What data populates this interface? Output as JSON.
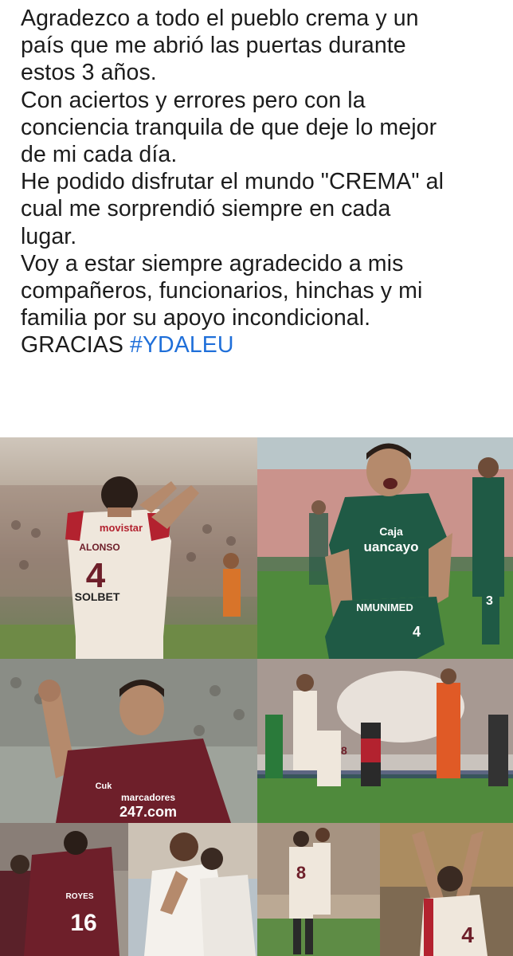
{
  "post": {
    "lines": [
      "Agradezco a todo el pueblo crema y un",
      "país que me abrió las puertas durante",
      "estos 3 años.",
      "Con aciertos y errores pero con la",
      "conciencia tranquila de que deje lo mejor",
      "de mi cada día.",
      "He podido disfrutar el mundo \"CREMA\" al",
      "cual me sorprendió siempre en cada",
      "lugar.",
      "Voy a estar siempre agradecido a mis",
      "compañeros, funcionarios, hinchas y mi",
      "familia por su apoyo incondicional."
    ],
    "last_prefix": "GRACIAS ",
    "hashtag": "#YDALEU",
    "hashtag_color": "#1f6fd9"
  },
  "photos": {
    "p1": {
      "name": "ALONSO",
      "number": "4",
      "sponsor_top": "movistar",
      "sponsor": "SOLBET"
    },
    "p2": {
      "sponsor_line1": "Caja",
      "sponsor_line2": "uancayo",
      "sleeve": "NMUNIMED",
      "number": "4",
      "teammate_number": "3"
    },
    "p3": {
      "sponsor_line1": "marcadores",
      "sponsor_line2": "247.com",
      "chest": "Cuk"
    },
    "p4": {
      "number": "8"
    },
    "p5": {
      "number": "16",
      "name": "ROYES"
    },
    "p7": {
      "number": "8"
    },
    "p8": {
      "number": "4"
    }
  },
  "colors": {
    "crema": "#efe7dc",
    "granate": "#6e1f2a",
    "green_kit": "#1f5a45",
    "pitch": "#4f8a3c"
  }
}
